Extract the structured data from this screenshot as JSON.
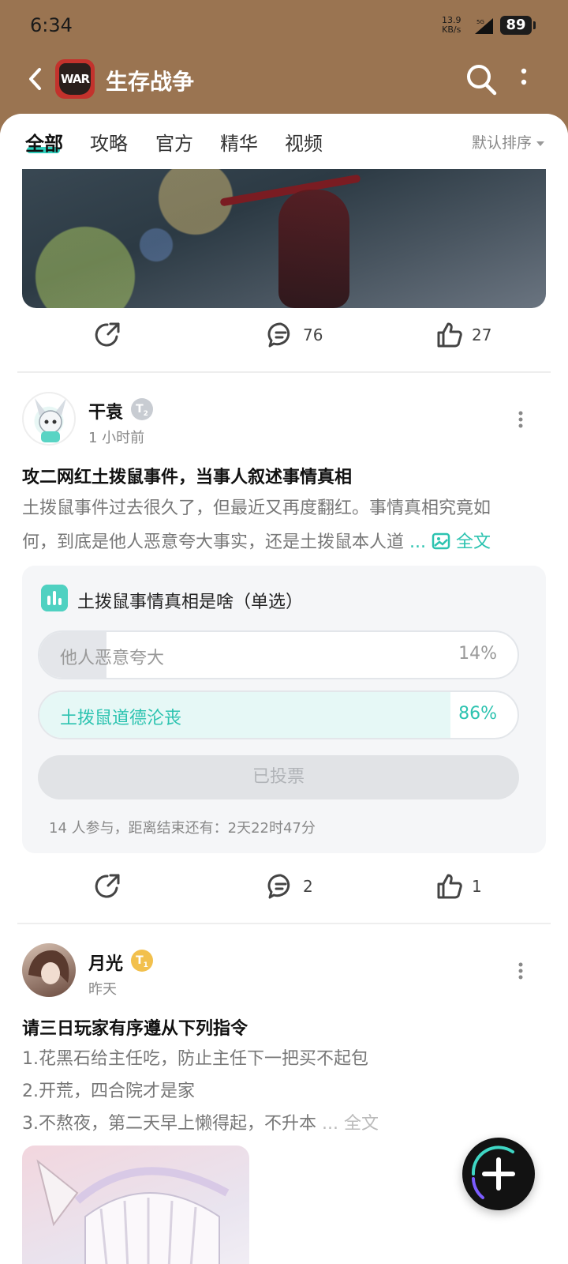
{
  "status_bar": {
    "time": "6:34",
    "net_speed_value": "13.9",
    "net_speed_unit": "KB/s",
    "network": "5G",
    "battery": "89"
  },
  "app_bar": {
    "title": "生存战争",
    "logo_text": "WAR"
  },
  "tabs": [
    {
      "label": "全部",
      "active": true
    },
    {
      "label": "攻略",
      "active": false
    },
    {
      "label": "官方",
      "active": false
    },
    {
      "label": "精华",
      "active": false
    },
    {
      "label": "视频",
      "active": false
    }
  ],
  "sort_label": "默认排序",
  "posts": [
    {
      "comments": "76",
      "likes": "27"
    },
    {
      "user": "干袁",
      "badge": "T",
      "badge_level": "2",
      "time": "1 小时前",
      "title": "攻二网红土拨鼠事件，当事人叙述事情真相",
      "body_line1": "土拨鼠事件过去很久了，但最近又再度翻红。事情真相究竟如",
      "body_line2": "何，到底是他人恶意夸大事实，还是土拨鼠本人道",
      "ellipsis": "...",
      "full_text": "全文",
      "poll": {
        "title": "土拨鼠事情真相是啥（单选）",
        "options": [
          {
            "label": "他人恶意夸大",
            "percent": "14%",
            "fraction": 0.14,
            "selected": false
          },
          {
            "label": "土拨鼠道德沦丧",
            "percent": "86%",
            "fraction": 0.86,
            "selected": true
          }
        ],
        "voted_label": "已投票",
        "footer": "14 人参与，距离结束还有：2天22时47分"
      },
      "comments": "2",
      "likes": "1"
    },
    {
      "user": "月光",
      "badge": "T",
      "badge_level": "1",
      "time": "昨天",
      "title": "请三日玩家有序遵从下列指令",
      "body_line1": "1.花黑石给主任吃，防止主任下一把买不起包",
      "body_line2": "2.开荒，四合院才是家",
      "body_line3": "3.不熬夜，第二天早上懒得起，不升本",
      "ellipsis": "...",
      "full_text": "全文"
    }
  ],
  "colors": {
    "header_bg": "#9a7451",
    "accent": "#2cc3b0",
    "fab_bg": "#121212"
  }
}
